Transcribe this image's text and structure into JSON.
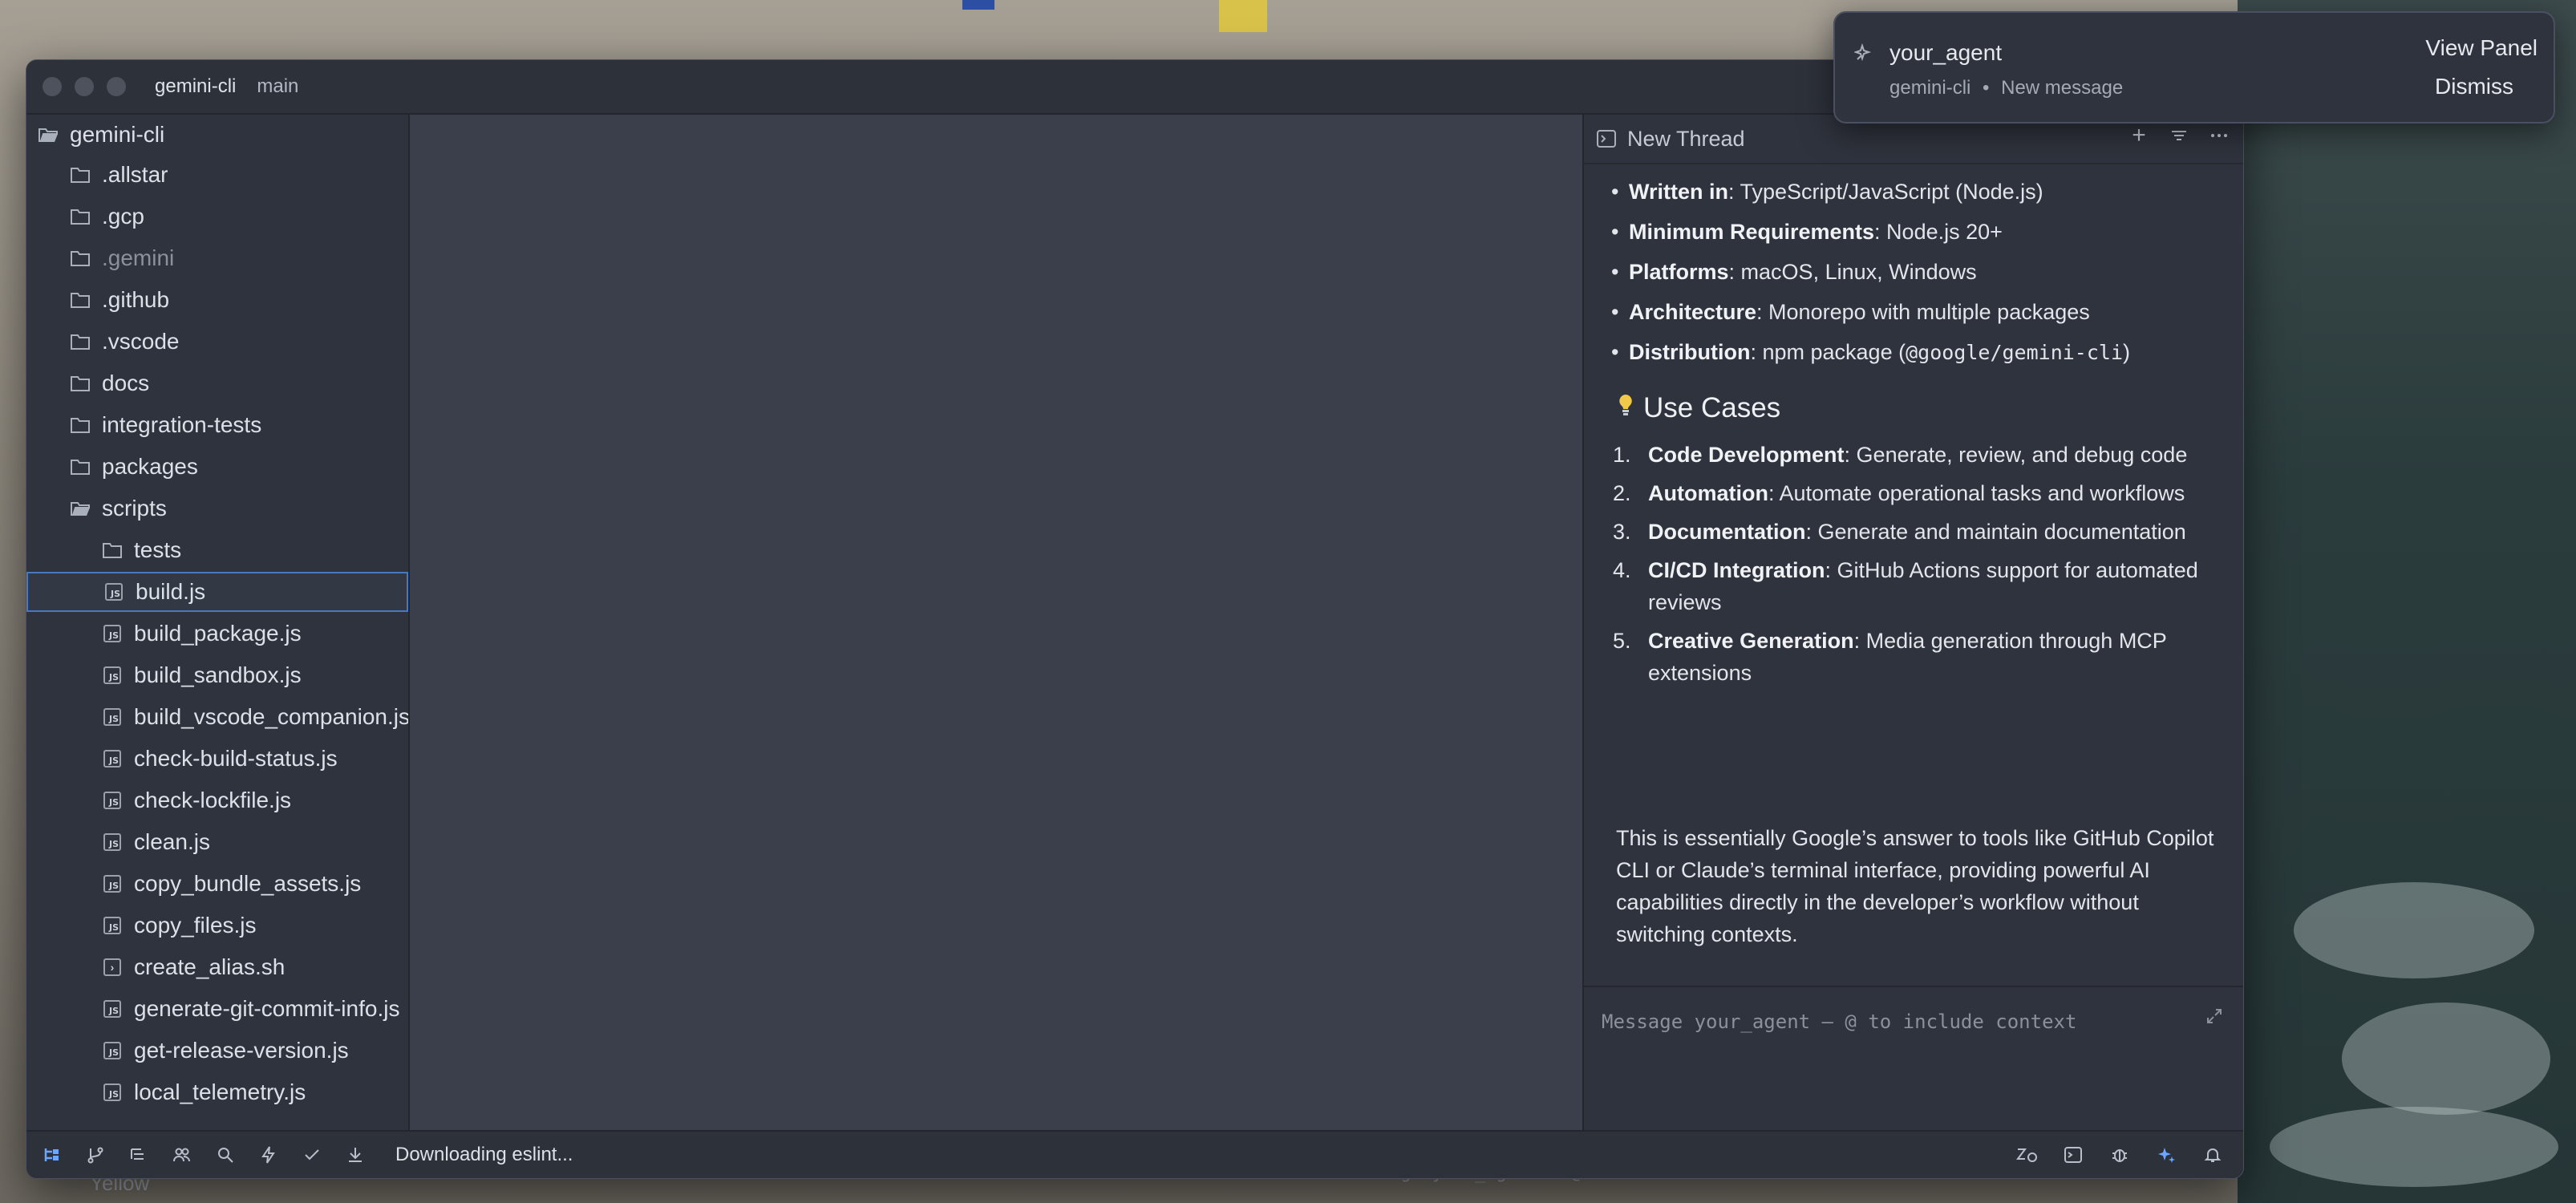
{
  "window": {
    "project": "gemini-cli",
    "branch": "main"
  },
  "sidebar": {
    "root": "gemini-cli",
    "items": [
      {
        "label": ".allstar",
        "type": "folder",
        "depth": 1
      },
      {
        "label": ".gcp",
        "type": "folder",
        "depth": 1
      },
      {
        "label": ".gemini",
        "type": "folder",
        "depth": 1,
        "dim": true
      },
      {
        "label": ".github",
        "type": "folder",
        "depth": 1
      },
      {
        "label": ".vscode",
        "type": "folder",
        "depth": 1
      },
      {
        "label": "docs",
        "type": "folder",
        "depth": 1
      },
      {
        "label": "integration-tests",
        "type": "folder",
        "depth": 1
      },
      {
        "label": "packages",
        "type": "folder",
        "depth": 1
      },
      {
        "label": "scripts",
        "type": "folder-open",
        "depth": 1
      },
      {
        "label": "tests",
        "type": "folder",
        "depth": 2
      },
      {
        "label": "build.js",
        "type": "js",
        "depth": 2,
        "selected": true
      },
      {
        "label": "build_package.js",
        "type": "js",
        "depth": 2
      },
      {
        "label": "build_sandbox.js",
        "type": "js",
        "depth": 2
      },
      {
        "label": "build_vscode_companion.js",
        "type": "js",
        "depth": 2
      },
      {
        "label": "check-build-status.js",
        "type": "js",
        "depth": 2
      },
      {
        "label": "check-lockfile.js",
        "type": "js",
        "depth": 2
      },
      {
        "label": "clean.js",
        "type": "js",
        "depth": 2
      },
      {
        "label": "copy_bundle_assets.js",
        "type": "js",
        "depth": 2
      },
      {
        "label": "copy_files.js",
        "type": "js",
        "depth": 2
      },
      {
        "label": "create_alias.sh",
        "type": "sh",
        "depth": 2
      },
      {
        "label": "generate-git-commit-info.js",
        "type": "js",
        "depth": 2
      },
      {
        "label": "get-release-version.js",
        "type": "js",
        "depth": 2
      },
      {
        "label": "local_telemetry.js",
        "type": "js",
        "depth": 2
      }
    ]
  },
  "panel": {
    "title": "New Thread",
    "bullets": [
      {
        "bold": "Written in",
        "rest": ": TypeScript/JavaScript (Node.js)"
      },
      {
        "bold": "Minimum Requirements",
        "rest": ": Node.js 20+"
      },
      {
        "bold": "Platforms",
        "rest": ": macOS, Linux, Windows"
      },
      {
        "bold": "Architecture",
        "rest": ": Monorepo with multiple packages"
      },
      {
        "bold": "Distribution",
        "rest_pre": ": npm package (",
        "code": "@google/gemini-cli",
        "rest_post": ")"
      }
    ],
    "use_cases_heading": "Use Cases",
    "use_cases": [
      {
        "num": "1.",
        "bold": "Code Development",
        "rest": ": Generate, review, and debug code"
      },
      {
        "num": "2.",
        "bold": "Automation",
        "rest": ": Automate operational tasks and workflows"
      },
      {
        "num": "3.",
        "bold": "Documentation",
        "rest": ": Generate and maintain documentation"
      },
      {
        "num": "4.",
        "bold": "CI/CD Integration",
        "rest": ": GitHub Actions support for automated reviews"
      },
      {
        "num": "5.",
        "bold": "Creative Generation",
        "rest": ": Media generation through MCP extensions"
      }
    ],
    "summary": "This is essentially Google’s answer to tools like GitHub Copilot CLI or Claude’s terminal interface, providing powerful AI capabilities directly in the developer’s workflow without switching contexts.",
    "composer_placeholder": "Message your_agent — @ to include context"
  },
  "statusbar": {
    "status": "Downloading eslint..."
  },
  "notification": {
    "title": "your_agent",
    "source": "gemini-cli",
    "separator": "•",
    "kind": "New message",
    "view_label": "View Panel",
    "dismiss_label": "Dismiss"
  },
  "background": {
    "peek_left": "Yellow",
    "peek_right": "Message your_agent — @ to include context"
  },
  "colors": {
    "accent": "#4a78c0",
    "active_icon": "#6ea6ff",
    "bulb": "#f1c94a"
  }
}
